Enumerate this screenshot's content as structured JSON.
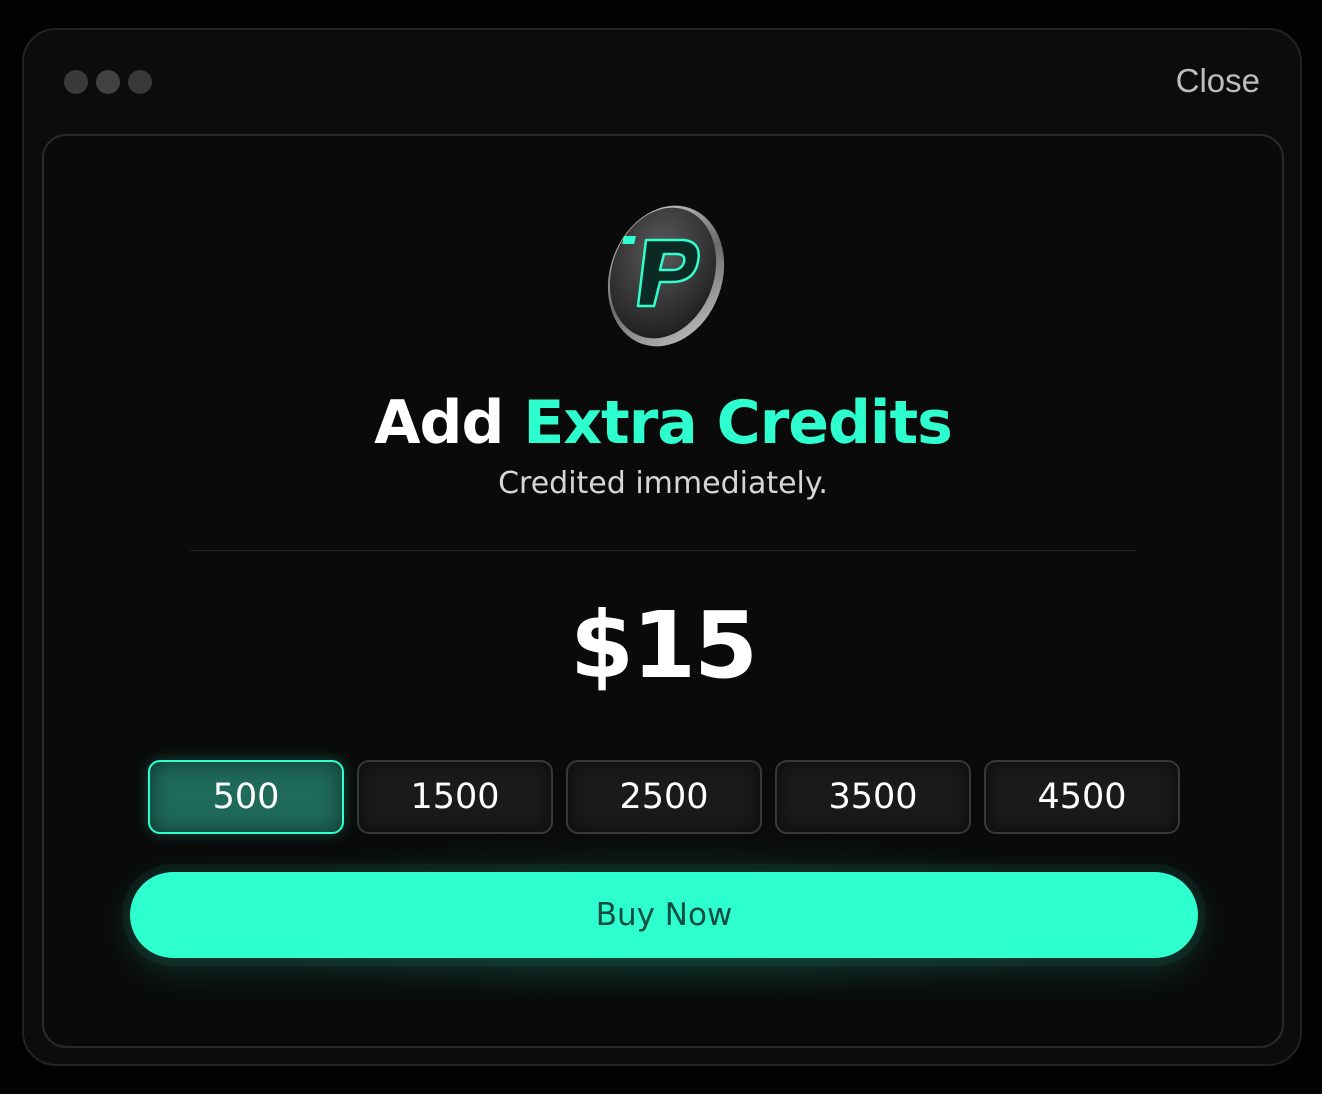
{
  "window": {
    "close_label": "Close"
  },
  "dialog": {
    "icon": "p-coin-icon",
    "title_prefix": "Add",
    "title_highlight": "Extra Credits",
    "subtitle": "Credited immediately.",
    "price": "$15",
    "options": [
      "500",
      "1500",
      "2500",
      "3500",
      "4500"
    ],
    "selected_option": "500",
    "buy_label": "Buy Now"
  },
  "colors": {
    "accent": "#2effce",
    "background": "#0a0a0a",
    "selected_option_bg": "#1f6a5b",
    "buy_text": "#0f3b33"
  }
}
